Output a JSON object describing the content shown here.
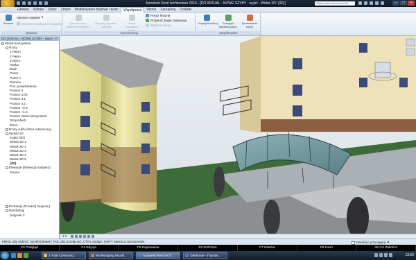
{
  "titlebar": {
    "title": "Autodesk Revit Architecture 2010 - [DO WIZUAL - NOWE SZYBY - wyjsć - Widok 3D: (3D)]",
    "search_placeholder": "Wpisz słowo kluczowe lub frazę"
  },
  "ribbon": {
    "tabs": [
      "Główne",
      "Wstaw",
      "Opisz",
      "Zmień",
      "Modelowanie bryłowe i teren",
      "Współpraca",
      "Widok",
      "Zarządzaj",
      "Dodatki"
    ],
    "active_tab": "Współpraca",
    "groups": {
      "worksets": {
        "label": "Zadania",
        "main_button": "Zadania",
        "active_workset": "Aktywne zadanie",
        "gray_inactive": "Wyszarz nieaktywne zadania"
      },
      "sync": {
        "label": "Synchronizuj",
        "buttons": [
          "Synchronizuj z plikiem centralnym",
          "Wczytaj prywatne zadania",
          "Pokaż wszystkie mogę",
          "Edytuj żądania"
        ],
        "history": "Pokaż historię",
        "backup": "Przywróć kopię zapasową",
        "request": "Żądanie edycji"
      },
      "coordinate": {
        "label": "Współrzędne",
        "buttons": [
          "Kopiuj/Monitoruj",
          "Przegląd współrzędnych",
          "Sprawdzanie kolizji"
        ]
      }
    }
  },
  "browser": {
    "title": "DO WIZUAL - NOWE SZYBY - wyjsć - P...",
    "nodes": [
      {
        "label": "Widoki (wszystkie)",
        "toggle": "-",
        "depth": 0
      },
      {
        "label": "Rzuty",
        "toggle": "-",
        "depth": 1
      },
      {
        "label": "1 Piętro",
        "toggle": "",
        "depth": 2
      },
      {
        "label": "2 Piętro",
        "toggle": "",
        "depth": 2
      },
      {
        "label": "3 piętro",
        "toggle": "",
        "depth": 2
      },
      {
        "label": "Attyka",
        "toggle": "",
        "depth": 2
      },
      {
        "label": "Dach",
        "toggle": "",
        "depth": 2
      },
      {
        "label": "Parter",
        "toggle": "",
        "depth": 2
      },
      {
        "label": "Parter A",
        "toggle": "",
        "depth": 2
      },
      {
        "label": "Piwnica",
        "toggle": "",
        "depth": 2
      },
      {
        "label": "Poz. posadowienia",
        "toggle": "",
        "depth": 2
      },
      {
        "label": "Poziom 0",
        "toggle": "",
        "depth": 2
      },
      {
        "label": "Poziom 4.00",
        "toggle": "",
        "depth": 2
      },
      {
        "label": "Poziom 4.1",
        "toggle": "",
        "depth": 2
      },
      {
        "label": "Poziom 4.2",
        "toggle": "",
        "depth": 2
      },
      {
        "label": "Poziom ~2.8",
        "toggle": "",
        "depth": 2
      },
      {
        "label": "Poziom ~1.5",
        "toggle": "",
        "depth": 2
      },
      {
        "label": "Poziom zieleni stropodach",
        "toggle": "",
        "depth": 2
      },
      {
        "label": "Stropodach",
        "toggle": "",
        "depth": 2
      },
      {
        "label": "Teren",
        "toggle": "",
        "depth": 2
      },
      {
        "label": "Rzuty sufitu (Rzut odwrócony)",
        "toggle": "+",
        "depth": 1
      },
      {
        "label": "Widoki 3D",
        "toggle": "-",
        "depth": 1
      },
      {
        "label": "Kopia {3D}",
        "toggle": "",
        "depth": 2
      },
      {
        "label": "Widok 3D 1",
        "toggle": "",
        "depth": 2
      },
      {
        "label": "Widok 3D 2",
        "toggle": "",
        "depth": 2
      },
      {
        "label": "Widok 3D 3",
        "toggle": "",
        "depth": 2
      },
      {
        "label": "Widok 3D 4",
        "toggle": "",
        "depth": 2
      },
      {
        "label": "Widok 3D 5",
        "toggle": "",
        "depth": 2
      },
      {
        "label": "{3D}",
        "toggle": "",
        "depth": 2,
        "bold": true
      },
      {
        "label": "Elewacje (Elewacja budynku)",
        "toggle": "-",
        "depth": 1
      },
      {
        "label": "Ściana",
        "toggle": "",
        "depth": 2
      },
      {
        "label": "",
        "toggle": "",
        "depth": 2
      },
      {
        "label": "",
        "toggle": "",
        "depth": 2
      },
      {
        "label": "",
        "toggle": "",
        "depth": 2
      },
      {
        "label": "",
        "toggle": "",
        "depth": 2
      },
      {
        "label": "",
        "toggle": "",
        "depth": 2
      },
      {
        "label": "",
        "toggle": "",
        "depth": 2
      },
      {
        "label": "",
        "toggle": "",
        "depth": 2
      },
      {
        "label": "Przekroje (Przekrój budynku)",
        "toggle": "+",
        "depth": 1
      },
      {
        "label": "Renderingi",
        "toggle": "-",
        "depth": 1
      },
      {
        "label": "budynek C",
        "toggle": "",
        "depth": 2
      }
    ]
  },
  "view_bar": {
    "scale": "1:1"
  },
  "status": {
    "hint": "Kliknij, aby wybrać; naciśnij klawisz TAB, aby przełączyć; CTRL dodaje; SHIFT odwraca zaznaczenie.",
    "filter_label": "Naciśnij i przeciągnij"
  },
  "function_keys": [
    "F3 Podgląd",
    "F4 Edycja",
    "F5 Kopiowanie",
    "F6 ZmPrzes",
    "F7 UtwKat",
    "F8 Usuń",
    "Alt+F4 Zakończ"
  ],
  "taskbar": {
    "items": [
      {
        "label": "2 Total Command...",
        "icon_color": "#e9c23a",
        "active": false
      },
      {
        "label": "Workshaping Mozilli...",
        "icon_color": "#e07a2b",
        "active": false
      },
      {
        "label": "Autodesk Revit Arch...",
        "icon_color": "#3a86c8",
        "active": true
      },
      {
        "label": "Odebrane - Thunde...",
        "icon_color": "#4d7fc2",
        "active": false
      }
    ],
    "clock": "13:56"
  }
}
